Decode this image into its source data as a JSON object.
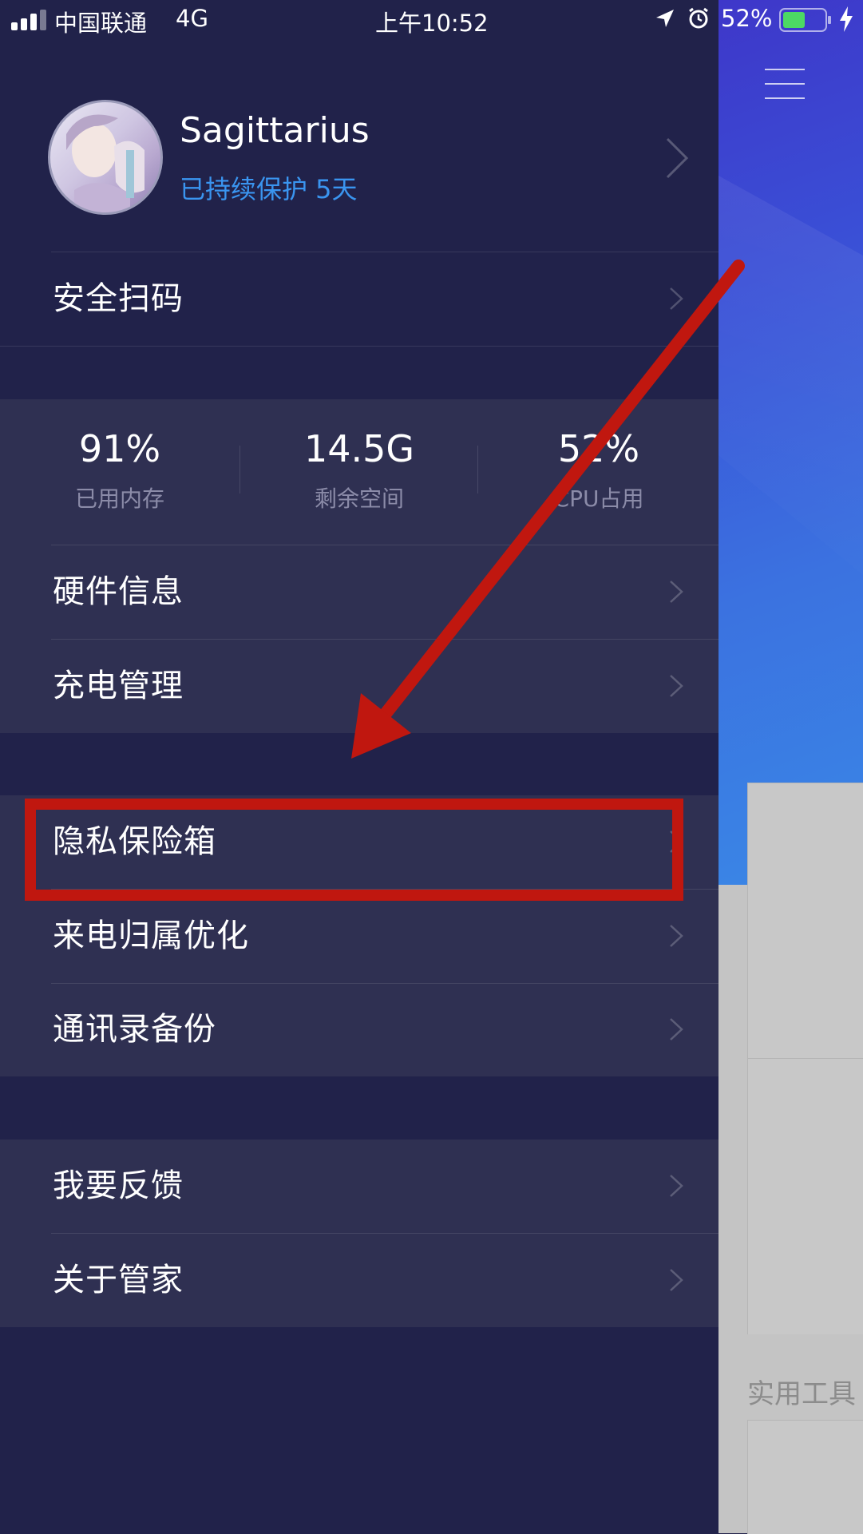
{
  "status_bar": {
    "carrier": "中国联通",
    "network": "4G",
    "time": "上午10:52",
    "battery": "52%"
  },
  "profile": {
    "username": "Sagittarius",
    "protection": "已持续保护 5天"
  },
  "menu_top": [
    {
      "label": "安全扫码"
    }
  ],
  "stats": [
    {
      "value": "91%",
      "label": "已用内存"
    },
    {
      "value": "14.5G",
      "label": "剩余空间"
    },
    {
      "value": "52%",
      "label": "CPU占用"
    }
  ],
  "menu_device": [
    {
      "label": "硬件信息"
    },
    {
      "label": "充电管理"
    }
  ],
  "menu_privacy": [
    {
      "label": "隐私保险箱"
    },
    {
      "label": "来电归属优化"
    },
    {
      "label": "通讯录备份"
    }
  ],
  "menu_about": [
    {
      "label": "我要反馈"
    },
    {
      "label": "关于管家"
    }
  ],
  "background": {
    "tools_label": "实用工具"
  },
  "colors": {
    "drawer_bg": "#21224a",
    "section_bg": "#2f3052",
    "accent_blue": "#3a95f0",
    "annotation_red": "#c0170f"
  }
}
